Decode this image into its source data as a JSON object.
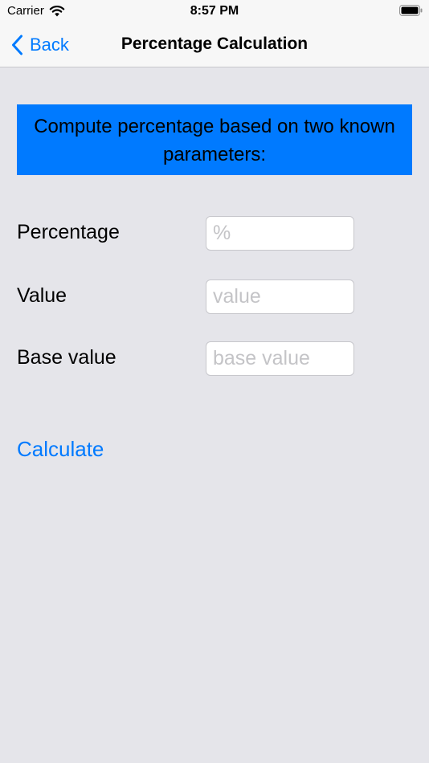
{
  "status_bar": {
    "carrier": "Carrier",
    "time": "8:57 PM",
    "wifi_icon": "wifi-icon",
    "battery_icon": "battery-full-icon"
  },
  "nav": {
    "back_label": "Back",
    "back_icon": "chevron-left-icon",
    "title": "Percentage Calculation"
  },
  "banner": {
    "text": "Compute percentage based on two known parameters:"
  },
  "form": {
    "fields": [
      {
        "label": "Percentage",
        "value": "",
        "placeholder": "%"
      },
      {
        "label": "Value",
        "value": "",
        "placeholder": "value"
      },
      {
        "label": "Base value",
        "value": "",
        "placeholder": "base value"
      }
    ],
    "calculate_label": "Calculate"
  },
  "colors": {
    "accent": "#007aff",
    "background": "#e5e5ea",
    "bar_background": "#f7f7f7",
    "banner": "#007aff"
  }
}
